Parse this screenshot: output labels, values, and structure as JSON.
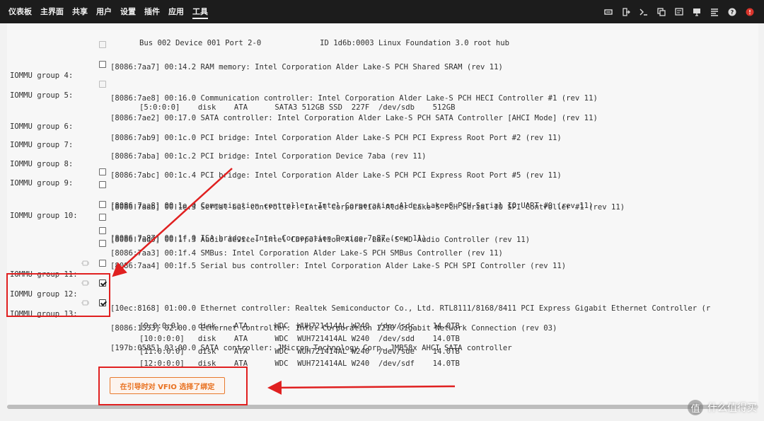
{
  "nav": [
    "仪表板",
    "主界面",
    "共享",
    "用户",
    "设置",
    "插件",
    "应用",
    "工具"
  ],
  "nav_active_index": 7,
  "toolbar_icons": [
    "sync-icon",
    "logout-icon",
    "terminal-icon",
    "copy-icon",
    "notes-icon",
    "monitor-icon",
    "list-icon",
    "help-icon",
    "power-icon"
  ],
  "colors": {
    "accent": "#e8701f",
    "annotation": "#e02020",
    "topbar": "#1c1c1c"
  },
  "lines": {
    "usb": "Bus 002 Device 001 Port 2-0             ID 1d6b:0003 Linux Foundation 3.0 root hub",
    "sram": "[8086:7aa7] 00:14.2 RAM memory: Intel Corporation Alder Lake-S PCH Shared SRAM (rev 11)",
    "g4_label": "IOMMU group 4:",
    "g4": "[8086:7ae8] 00:16.0 Communication controller: Intel Corporation Alder Lake-S PCH HECI Controller #1 (rev 11)",
    "g5_label": "IOMMU group 5:",
    "g5": "[8086:7ae2] 00:17.0 SATA controller: Intel Corporation Alder Lake-S PCH SATA Controller [AHCI Mode] (rev 11)",
    "g5_disk": "[5:0:0:0]    disk    ATA      SATA3 512GB SSD  227F  /dev/sdb    512GB",
    "g6_label": "IOMMU group 6:",
    "g6": "[8086:7ab9] 00:1c.0 PCI bridge: Intel Corporation Alder Lake-S PCH PCI Express Root Port #2 (rev 11)",
    "g7_label": "IOMMU group 7:",
    "g7": "[8086:7aba] 00:1c.2 PCI bridge: Intel Corporation Device 7aba (rev 11)",
    "g8_label": "IOMMU group 8:",
    "g8": "[8086:7abc] 00:1c.4 PCI bridge: Intel Corporation Alder Lake-S PCH PCI Express Root Port #5 (rev 11)",
    "g9_label": "IOMMU group 9:",
    "g9a": "[8086:7aa8] 00:1e.0 Communication controller: Intel Corporation Alder Lake-S PCH Serial IO UART #0 (rev 11)",
    "g9b": "[8086:7aab] 00:1e.3 Serial bus controller: Intel Corporation Alder Lake-S PCH Serial IO SPI Controller #1 (rev 11)",
    "g10_label": "IOMMU group 10:",
    "g10a": "[8086:7a87] 00:1f.0 ISA bridge: Intel Corporation Device 7a87 (rev 11)",
    "g10b": "[8086:7ad0] 00:1f.3 Audio device: Intel Corporation Alder Lake-S HD Audio Controller (rev 11)",
    "g10c": "[8086:7aa3] 00:1f.4 SMBus: Intel Corporation Alder Lake-S PCH SMBus Controller (rev 11)",
    "g10d": "[8086:7aa4] 00:1f.5 Serial bus controller: Intel Corporation Alder Lake-S PCH SPI Controller (rev 11)",
    "g11_label": "IOMMU group 11:",
    "g11": "[10ec:8168] 01:00.0 Ethernet controller: Realtek Semiconductor Co., Ltd. RTL8111/8168/8411 PCI Express Gigabit Ethernet Controller (r",
    "g12_label": "IOMMU group 12:",
    "g12": "[8086:1533] 02:00.0 Ethernet controller: Intel Corporation I210 Gigabit Network Connection (rev 03)",
    "g13_label": "IOMMU group 13:",
    "g13": "[197b:0585] 03:00.0 SATA controller: JMicron Technology Corp. JMB58x AHCI SATA controller",
    "g13_d1": "[9:0:0:0]    disk    ATA      WDC  WUH721414AL W240  /dev/sdc    14.0TB",
    "g13_d2": "[10:0:0:0]   disk    ATA      WDC  WUH721414AL W240  /dev/sdd    14.0TB",
    "g13_d3": "[11:0:0:0]   disk    ATA      WDC  WUH721414AL W240  /dev/sde    14.0TB",
    "g13_d4": "[12:0:0:0]   disk    ATA      WDC  WUH721414AL W240  /dev/sdf    14.0TB"
  },
  "vfio_button": "在引导时对 VFIO 选择了绑定",
  "watermark": "什么值得买",
  "watermark_logo": "值"
}
